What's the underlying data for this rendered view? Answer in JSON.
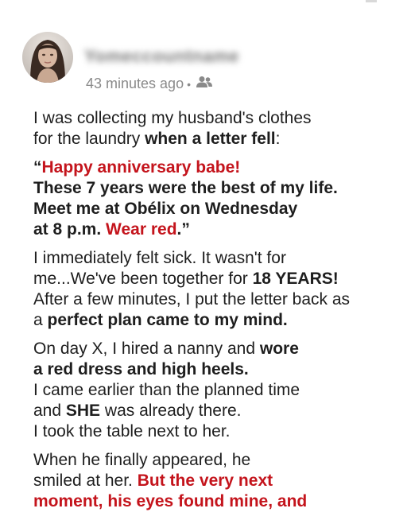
{
  "post": {
    "author_name": "Yomeccountname",
    "time_ago": "43 minutes ago",
    "audience_icon": "friends-icon",
    "colors": {
      "accent_red": "#c4141c",
      "meta_gray": "#8a8a8a",
      "text": "#1e1e1e"
    }
  },
  "story": {
    "p1": {
      "l1": "I was collecting my husband's clothes",
      "l2a": "for the laundry ",
      "l2b": "when a letter fell",
      "l2c": ":"
    },
    "p2": {
      "l1a": "“",
      "l1b": "Happy anniversary babe!",
      "l2": "These 7 years were the best of my life.",
      "l3": "Meet me at Obélix on Wednesday",
      "l4a": "at 8 p.m. ",
      "l4b": "Wear red",
      "l4c": ".”"
    },
    "p3": {
      "l1": "I immediately felt sick. It wasn't for",
      "l2a": "me...We've been together for ",
      "l2b": "18 YEARS!",
      "l3": "After a few minutes, I put the letter back as",
      "l4a": "a ",
      "l4b": "perfect plan came to my mind."
    },
    "p4": {
      "l1a": "On day X, I hired a nanny and ",
      "l1b": "wore",
      "l2": "a red dress and high heels.",
      "l3": "I came earlier than the planned time",
      "l4a": "and ",
      "l4b": "SHE",
      "l4c": " was already there.",
      "l5": "I took the table next to her."
    },
    "p5": {
      "l1": "When he finally appeared, he",
      "l2a": "smiled at her. ",
      "l2b": "But the very next",
      "l3": "moment, his eyes found mine, and"
    }
  }
}
